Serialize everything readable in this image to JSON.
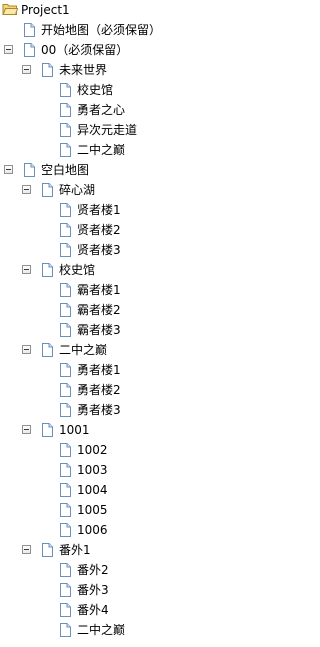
{
  "tree": {
    "nodes": [
      {
        "label": "Project1",
        "level": 0,
        "type": "project",
        "expanded": true,
        "has_children": true
      },
      {
        "label": "开始地图（必须保留）",
        "level": 1,
        "type": "map",
        "has_children": false
      },
      {
        "label": "00（必须保留）",
        "level": 1,
        "type": "map",
        "expanded": true,
        "has_children": true
      },
      {
        "label": "未来世界",
        "level": 2,
        "type": "map",
        "expanded": true,
        "has_children": true
      },
      {
        "label": "校史馆",
        "level": 3,
        "type": "map",
        "has_children": false
      },
      {
        "label": "勇者之心",
        "level": 3,
        "type": "map",
        "has_children": false
      },
      {
        "label": "异次元走道",
        "level": 3,
        "type": "map",
        "has_children": false
      },
      {
        "label": "二中之巅",
        "level": 3,
        "type": "map",
        "has_children": false
      },
      {
        "label": "空白地图",
        "level": 1,
        "type": "map",
        "expanded": true,
        "has_children": true
      },
      {
        "label": "碎心湖",
        "level": 2,
        "type": "map",
        "expanded": true,
        "has_children": true
      },
      {
        "label": "贤者楼1",
        "level": 3,
        "type": "map",
        "has_children": false
      },
      {
        "label": "贤者楼2",
        "level": 3,
        "type": "map",
        "has_children": false
      },
      {
        "label": "贤者楼3",
        "level": 3,
        "type": "map",
        "has_children": false
      },
      {
        "label": "校史馆",
        "level": 2,
        "type": "map",
        "expanded": true,
        "has_children": true
      },
      {
        "label": "霸者楼1",
        "level": 3,
        "type": "map",
        "has_children": false
      },
      {
        "label": "霸者楼2",
        "level": 3,
        "type": "map",
        "has_children": false
      },
      {
        "label": "霸者楼3",
        "level": 3,
        "type": "map",
        "has_children": false
      },
      {
        "label": "二中之巅",
        "level": 2,
        "type": "map",
        "expanded": true,
        "has_children": true
      },
      {
        "label": "勇者楼1",
        "level": 3,
        "type": "map",
        "has_children": false
      },
      {
        "label": "勇者楼2",
        "level": 3,
        "type": "map",
        "has_children": false
      },
      {
        "label": "勇者楼3",
        "level": 3,
        "type": "map",
        "has_children": false
      },
      {
        "label": "1001",
        "level": 2,
        "type": "map",
        "expanded": true,
        "has_children": true
      },
      {
        "label": "1002",
        "level": 3,
        "type": "map",
        "has_children": false
      },
      {
        "label": "1003",
        "level": 3,
        "type": "map",
        "has_children": false
      },
      {
        "label": "1004",
        "level": 3,
        "type": "map",
        "has_children": false
      },
      {
        "label": "1005",
        "level": 3,
        "type": "map",
        "has_children": false
      },
      {
        "label": "1006",
        "level": 3,
        "type": "map",
        "has_children": false
      },
      {
        "label": "番外1",
        "level": 2,
        "type": "map",
        "expanded": true,
        "has_children": true
      },
      {
        "label": "番外2",
        "level": 3,
        "type": "map",
        "has_children": false
      },
      {
        "label": "番外3",
        "level": 3,
        "type": "map",
        "has_children": false
      },
      {
        "label": "番外4",
        "level": 3,
        "type": "map",
        "has_children": false
      },
      {
        "label": "二中之巅",
        "level": 3,
        "type": "map",
        "has_children": false
      }
    ]
  },
  "colors": {
    "folder_fill": "#f5d77a",
    "folder_stroke": "#a88a2c",
    "page_fill": "#ffffff",
    "page_stroke": "#6b8fbf",
    "expander_border": "#919191"
  },
  "icons": {
    "project": "open-folder-icon",
    "map": "map-page-icon",
    "expander": "collapse-toggle-icon"
  }
}
